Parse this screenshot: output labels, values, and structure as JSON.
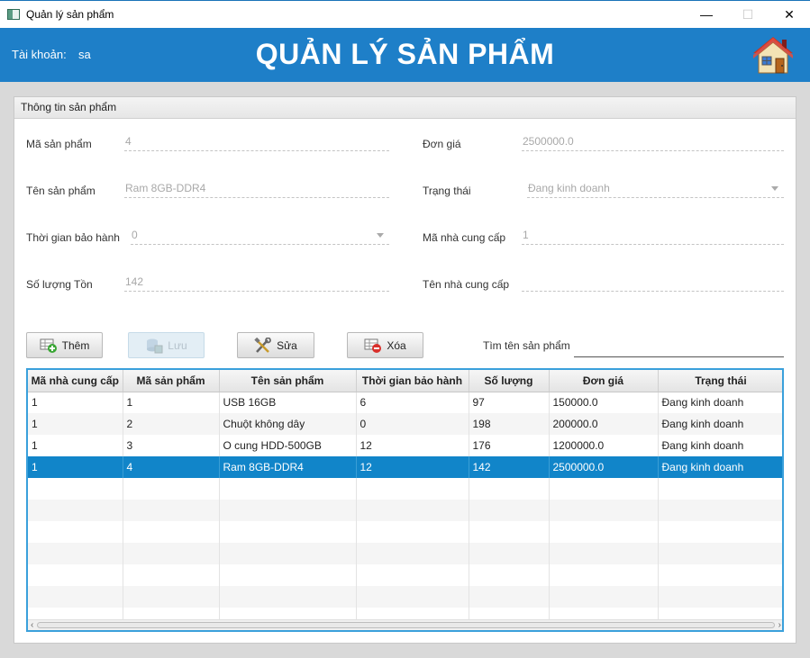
{
  "window": {
    "title": "Quản lý sản phẩm",
    "minimize": "—",
    "maximize": "☐",
    "close": "✕"
  },
  "header": {
    "account_label": "Tài khoản:",
    "account_value": "sa",
    "heading": "QUẢN LÝ SẢN PHẨM"
  },
  "panel": {
    "title": "Thông tin sản phẩm"
  },
  "form": {
    "ma_san_pham": {
      "label": "Mã sản phẩm",
      "value": "4"
    },
    "ten_san_pham": {
      "label": "Tên sản phẩm",
      "value": "Ram 8GB-DDR4"
    },
    "thoi_gian_bao_hanh": {
      "label": "Thời gian bảo hành",
      "value": "0"
    },
    "so_luong_ton": {
      "label": "Số lượng Tồn",
      "value": "142"
    },
    "don_gia": {
      "label": "Đơn giá",
      "value": "2500000.0"
    },
    "trang_thai": {
      "label": "Trạng thái",
      "value": "Đang kinh doanh"
    },
    "ma_nha_cung_cap": {
      "label": "Mã nhà cung cấp",
      "value": "1"
    },
    "ten_nha_cung_cap": {
      "label": "Tên nhà cung cấp",
      "value": ""
    }
  },
  "buttons": {
    "them": "Thêm",
    "luu": "Lưu",
    "sua": "Sửa",
    "xoa": "Xóa"
  },
  "search": {
    "label": "Tìm tên sản phẩm",
    "value": ""
  },
  "table": {
    "columns": [
      "Mã nhà cung cấp",
      "Mã sản phẩm",
      "Tên sản phẩm",
      "Thời gian bảo hành",
      "Số lượng",
      "Đơn giá",
      "Trạng thái"
    ],
    "rows": [
      [
        "1",
        "1",
        "USB 16GB",
        "6",
        "97",
        "150000.0",
        "Đang kinh doanh"
      ],
      [
        "1",
        "2",
        "Chuột không dây",
        "0",
        "198",
        "200000.0",
        "Đang kinh doanh"
      ],
      [
        "1",
        "3",
        "O cung HDD-500GB",
        "12",
        "176",
        "1200000.0",
        "Đang kinh doanh"
      ],
      [
        "1",
        "4",
        "Ram 8GB-DDR4",
        "12",
        "142",
        "2500000.0",
        "Đang kinh doanh"
      ]
    ],
    "selected_row": 3,
    "empty_rows": 7
  },
  "icons": {
    "app": "app-window-icon",
    "home": "home-icon",
    "them": "add-table-icon",
    "luu": "save-db-icon",
    "sua": "tools-icon",
    "xoa": "delete-table-icon"
  },
  "colors": {
    "header": "#1e7fc8",
    "selection": "#1185c9",
    "table_border": "#3aa0db"
  }
}
